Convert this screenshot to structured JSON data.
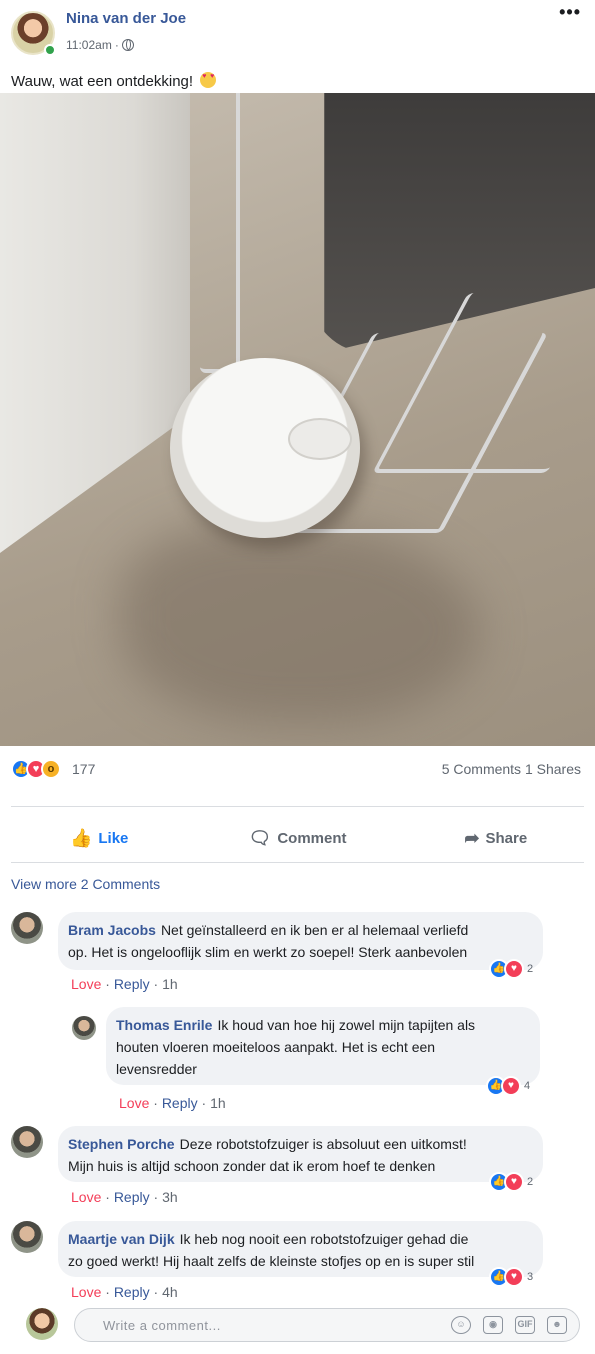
{
  "post": {
    "author": "Nina van der Joe",
    "time": "11:02am",
    "time_sep": "·",
    "text": "Wauw, wat een ontdekking!",
    "text_emoji": "heart-eyes-emoji",
    "more_label": "•••",
    "photo_icon": "photo-robot-vacuum"
  },
  "reactions": {
    "count": "177",
    "comments_shares": "5 Comments 1 Shares",
    "icons": [
      "like-icon",
      "love-icon",
      "wow-icon"
    ],
    "colors": {
      "like": "#1877f2",
      "love": "#f33e58",
      "wow": "#f7b125"
    }
  },
  "actions": {
    "like": "Like",
    "comment": "Comment",
    "share": "Share"
  },
  "view_more": "View more 2 Comments",
  "comments": [
    {
      "name": "Bram Jacobs",
      "line1": "Net geïnstalleerd en ik ben er al helemaal verliefd",
      "line2": "op. Het is ongelooflijk slim en werkt zo soepel! Sterk aanbevolen",
      "love": "Love",
      "reply": "Reply",
      "time": "1h",
      "reacts": "2"
    },
    {
      "name": "Thomas Enrile",
      "line1": "Ik houd van hoe hij zowel mijn tapijten als",
      "line2": "houten vloeren moeiteloos aanpakt. Het is echt een",
      "line3": "levensredder",
      "love": "Love",
      "reply": "Reply",
      "time": "1h",
      "reacts": "4"
    },
    {
      "name": "Stephen Porche",
      "line1": "Deze robotstofzuiger is absoluut een uitkomst!",
      "line2": "Mijn huis is altijd schoon zonder dat ik erom hoef te denken",
      "love": "Love",
      "reply": "Reply",
      "time": "3h",
      "reacts": "2"
    },
    {
      "name": "Maartje van Dijk",
      "line1": "Ik heb nog nooit een robotstofzuiger gehad die",
      "line2": "zo goed werkt! Hij haalt zelfs de kleinste stofjes op en is super stil",
      "love": "Love",
      "reply": "Reply",
      "time": "4h",
      "reacts": "3"
    }
  ],
  "composer": {
    "placeholder": "Write a comment...",
    "icons": [
      "emoji-icon",
      "camera-icon",
      "gif-icon",
      "sticker-icon"
    ]
  }
}
